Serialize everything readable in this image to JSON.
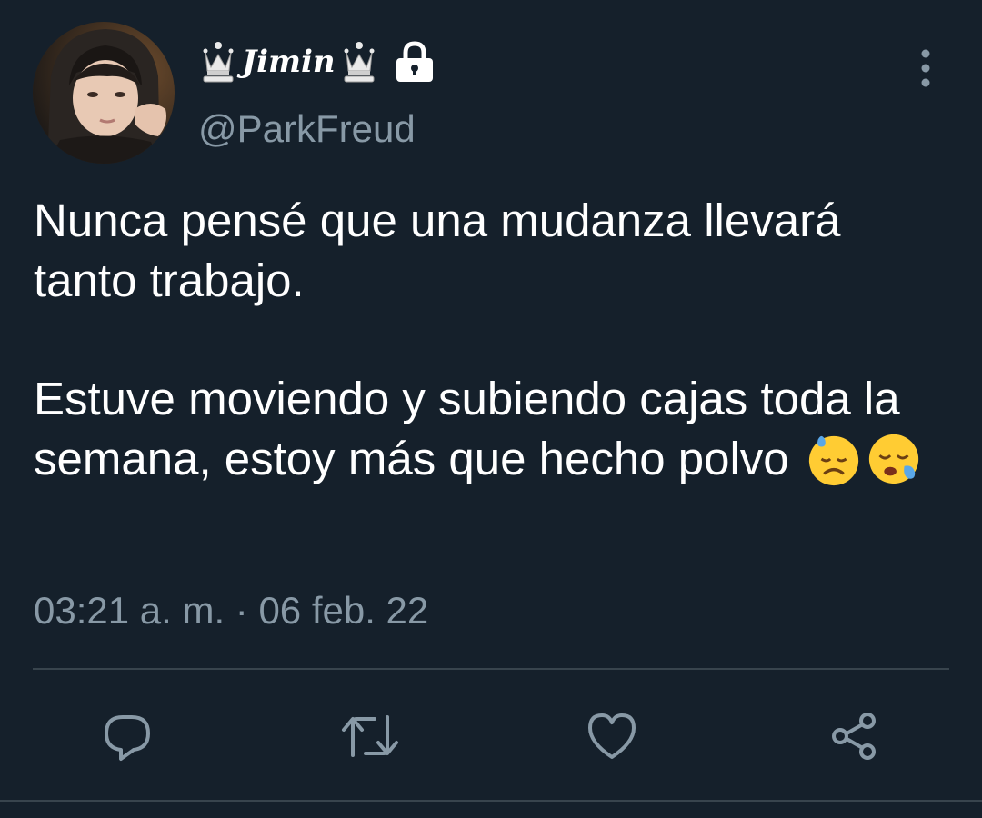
{
  "author": {
    "display_name": "Jimin",
    "handle": "@ParkFreud",
    "protected": true
  },
  "icons": {
    "avatar": "profile-photo",
    "crown": "chess-queen-icon",
    "lock": "lock-icon",
    "more": "vertical-ellipsis-icon",
    "reply": "reply-icon",
    "retweet": "retweet-icon",
    "like": "heart-icon",
    "share": "share-icon"
  },
  "tweet": {
    "text_line_1": "Nunca pensé que una mudanza llevará tanto trabajo.",
    "text_line_2": "Estuve moviendo y subiendo cajas toda la semana, estoy más que hecho polvo",
    "emojis": [
      "downcast-face-with-sweat",
      "sleepy-face"
    ],
    "timestamp": "03:21 a. m. · 06 feb. 22"
  },
  "colors": {
    "background": "#15202b",
    "text_primary": "#ffffff",
    "text_secondary": "#8899a6",
    "divider": "#38444d",
    "icon": "#8899a6"
  }
}
